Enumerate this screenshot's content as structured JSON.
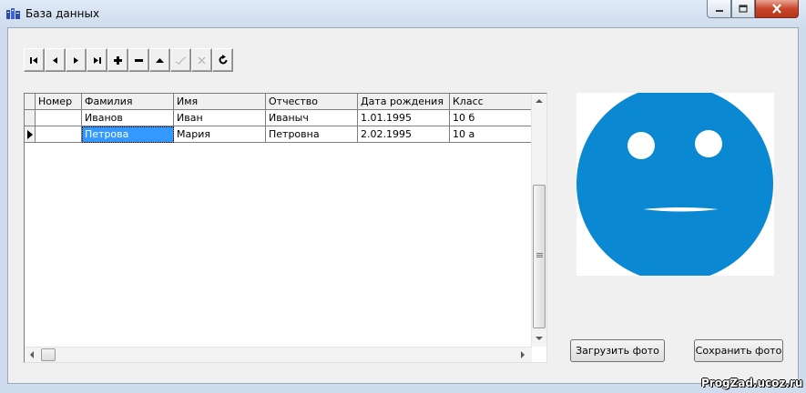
{
  "window": {
    "title": "База данных"
  },
  "grid": {
    "columns": [
      "Номер",
      "Фамилия",
      "Имя",
      "Отчество",
      "Дата рождения",
      "Класс"
    ],
    "rows": [
      [
        "",
        "Иванов",
        "Иван",
        "Иваныч",
        "1.01.1995",
        "10 б"
      ],
      [
        "",
        "Петрова",
        "Мария",
        "Петровна",
        "2.02.1995",
        "10 а"
      ]
    ]
  },
  "buttons": {
    "load_photo": "Загрузить фото",
    "save_photo": "Сохранить фото"
  },
  "watermark": "ProgZad.ucoz.ru",
  "colors": {
    "face": "#0a88d1",
    "selection": "#3399ff"
  }
}
